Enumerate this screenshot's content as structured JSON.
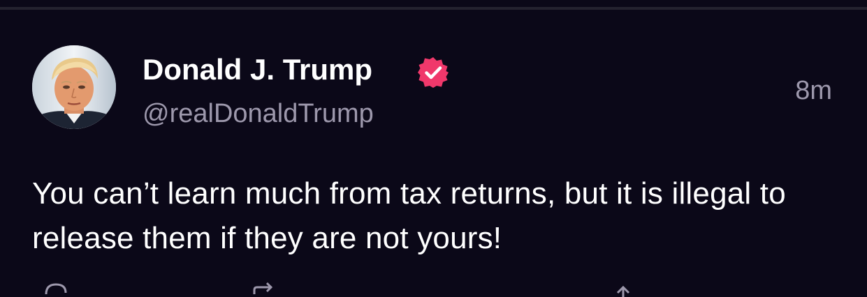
{
  "post": {
    "author_name": "Donald J. Trump",
    "handle": "@realDonaldTrump",
    "timestamp": "8m",
    "text": "You can’t learn much from tax returns, but it is illegal to release them if they are not yours!",
    "verified_icon": "verified-badge-icon",
    "verified_color": "#f0386b"
  },
  "actions": [
    {
      "icon": "reply-icon"
    },
    {
      "icon": "repost-icon"
    },
    {
      "icon": "like-icon"
    }
  ],
  "colors": {
    "background": "#0b0818",
    "primary_text": "#ffffff",
    "secondary_text": "#9d98ac",
    "divider": "#24222f"
  }
}
